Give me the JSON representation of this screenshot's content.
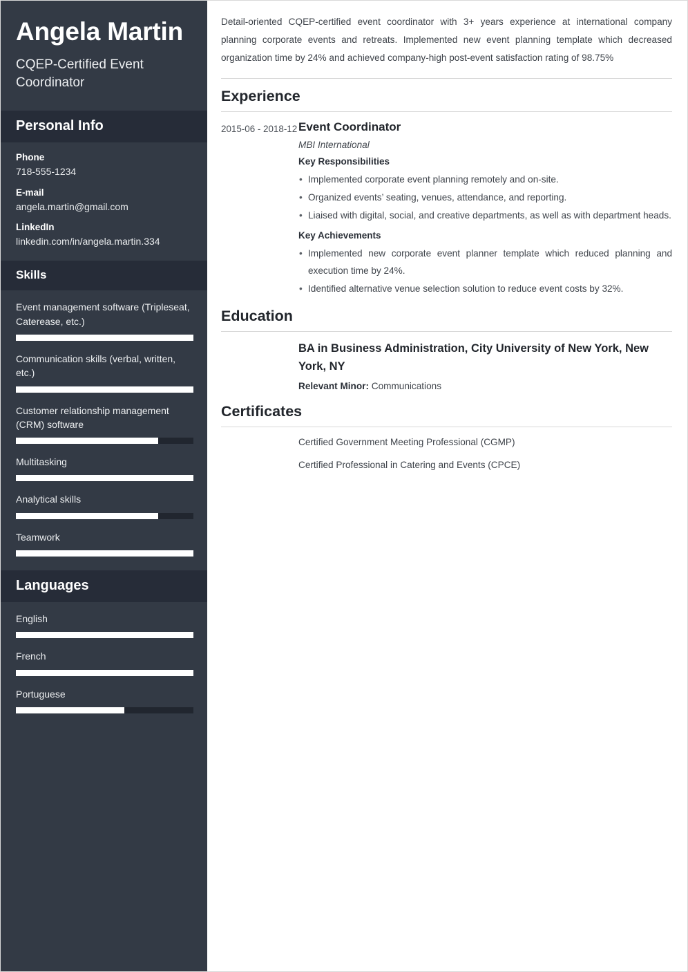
{
  "sidebar": {
    "name": "Angela Martin",
    "title": "CQEP-Certified Event Coordinator",
    "personal_info": {
      "heading": "Personal Info",
      "items": [
        {
          "label": "Phone",
          "value": "718-555-1234"
        },
        {
          "label": "E-mail",
          "value": "angela.martin@gmail.com"
        },
        {
          "label": "LinkedIn",
          "value": "linkedin.com/in/angela.martin.334"
        }
      ]
    },
    "skills": {
      "heading": "Skills",
      "items": [
        {
          "label": "Event management software (Tripleseat, Caterease, etc.)",
          "level": 100
        },
        {
          "label": "Communication skills (verbal, written, etc.)",
          "level": 100
        },
        {
          "label": "Customer relationship management (CRM) software",
          "level": 80
        },
        {
          "label": "Multitasking",
          "level": 100
        },
        {
          "label": "Analytical skills",
          "level": 80
        },
        {
          "label": "Teamwork",
          "level": 100
        }
      ]
    },
    "languages": {
      "heading": "Languages",
      "items": [
        {
          "label": "English",
          "level": 100
        },
        {
          "label": "French",
          "level": 100
        },
        {
          "label": "Portuguese",
          "level": 61
        }
      ]
    }
  },
  "main": {
    "summary": "Detail-oriented CQEP-certified event coordinator with 3+ years experience at international company planning corporate events and retreats. Implemented new event planning template which decreased organization time by 24% and achieved company-high post-event satisfaction rating of 98.75%",
    "experience": {
      "heading": "Experience",
      "entries": [
        {
          "dates": "2015-06 - 2018-12",
          "title": "Event Coordinator",
          "company": "MBI International",
          "responsibilities_heading": "Key Responsibilities",
          "responsibilities": [
            "Implemented corporate event planning remotely and on-site.",
            "Organized events’ seating, venues, attendance, and reporting.",
            "Liaised with digital, social, and creative departments, as well as with department heads."
          ],
          "achievements_heading": "Key Achievements",
          "achievements": [
            "Implemented new corporate event planner template which reduced planning and execution time by 24%.",
            "Identified alternative venue selection solution to reduce event costs by 32%."
          ]
        }
      ]
    },
    "education": {
      "heading": "Education",
      "entries": [
        {
          "degree": "BA in Business Administration, City University of New York, New York, NY",
          "detail_label": "Relevant Minor:",
          "detail_value": "Communications"
        }
      ]
    },
    "certificates": {
      "heading": "Certificates",
      "items": [
        "Certified Government Meeting Professional (CGMP)",
        "Certified Professional in Catering and Events (CPCE)"
      ]
    }
  }
}
